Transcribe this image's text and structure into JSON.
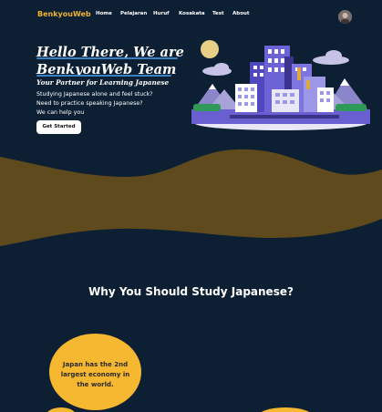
{
  "navbar": {
    "brand": "BenkyouWeb",
    "links": [
      "Home",
      "Pelajaran",
      "Huruf",
      "Kosakata",
      "Test",
      "About"
    ]
  },
  "hero": {
    "title_line1": "Hello There, We are",
    "title_line2": "BenkyouWeb Team",
    "subtitle": "Your Partner for Learning Japanese",
    "description": [
      "Studying Japanese alone and feel stuck?",
      "Need to practice speaking Japanese?",
      "We can help you"
    ],
    "cta_label": "Get Started"
  },
  "why_section": {
    "title": "Why You Should Study Japanese?",
    "facts": [
      "Japan has the 2nd largest economy in the world."
    ]
  },
  "colors": {
    "background": "#0c1f33",
    "brand": "#f0b42d",
    "wave": "#5e4a1c",
    "bubble": "#f6b731",
    "accent_underline": "#3b82c4"
  },
  "icons": {
    "avatar": "user-avatar",
    "illustration": "city-skyline-illustration"
  }
}
